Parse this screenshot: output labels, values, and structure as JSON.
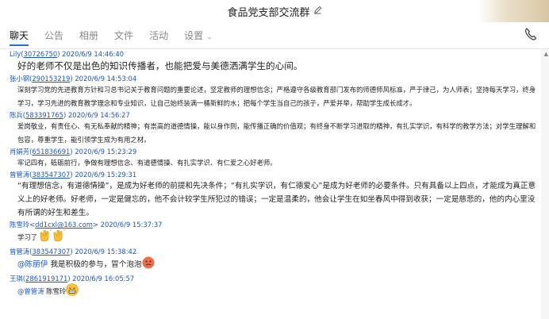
{
  "window": {
    "title": "食品党支部交流群",
    "edit_icon": "pencil-icon"
  },
  "tabs": [
    {
      "label": "聊天"
    },
    {
      "label": "公告"
    },
    {
      "label": "相册"
    },
    {
      "label": "文件"
    },
    {
      "label": "活动"
    },
    {
      "label": "设置"
    }
  ],
  "colors": {
    "accent": "#1a73e8",
    "sender": "#1a56c8",
    "text": "#222222"
  },
  "messages": [
    {
      "sender": "Lily",
      "id": "30726750",
      "time": "2020/6/9 14:46:40",
      "text": "好的老师不仅是出色的知识传播者，也能把爱与美德洒满学生的心间。"
    },
    {
      "sender": "张小钢",
      "id": "290153219",
      "time": "2020/6/9 14:53:04",
      "text": "深刻学习党的先进教育方针和习总书记关于教育问题的重要论述，坚定教师的理想信念；严格遵守各级教育部门发布的师德师风标准，严于律己，为人师表；坚持每天学习，终身学习，学习先进的教育教学理念和专业知识，让自己始终装满一桶新鲜的水；把每个学生当自己的孩子，严爱并举，帮助学生成长成才。"
    },
    {
      "sender": "陈兵",
      "id": "583391765",
      "time": "2020/6/9 14:56:27",
      "text": "爱岗敬业，有责任心、有无私奉献的精神；有崇高的道德情操，能以身作则，能传播正确的价值观；有终身不断学习进取的精神，有扎实学识，有科学的教学方法；对学生理解和包容，尊重学生，能引领学生成为有用之材。"
    },
    {
      "sender": "肖娟芳",
      "id": "651836691",
      "time": "2020/6/9 15:23:29",
      "text": "牢记四有，砥砺前行，争做有理想信念、有道德情操、有扎实学识、有仁爱之心好老师。"
    },
    {
      "sender": "曾管涛",
      "id": "383547307",
      "time": "2020/6/9 15:29:31",
      "text": "“有理想信念，有道德情操”，是成为好老师的前提和先决条件；“有扎实学识，有仁德爱心”是成为好老师的必要条件。只有具备以上四点，才能成为真正意义上的好老师。好老师，一定是健忘的，他不会计较学生所犯过的错误；一定是温柔的，他会让学生在如坐春风中得到收获；一定是慈悲的，他的内心里没有所谓的好生和差生。"
    },
    {
      "sender": "陈雪玲",
      "id": "dd1cxl@163.com",
      "time": "2020/6/9 15:37:37",
      "text": "学习了"
    },
    {
      "sender": "曾管涛",
      "id": "383547307",
      "time": "2020/6/9 15:38:42",
      "mention": "@陈丽伊",
      "text": "我是积极的参与，冒个泡泡"
    },
    {
      "sender": "王琪",
      "id": "2861919171",
      "time": "2020/6/9 16:05:57",
      "mention": "@曾管涛",
      "text": "陈雪玲"
    }
  ]
}
